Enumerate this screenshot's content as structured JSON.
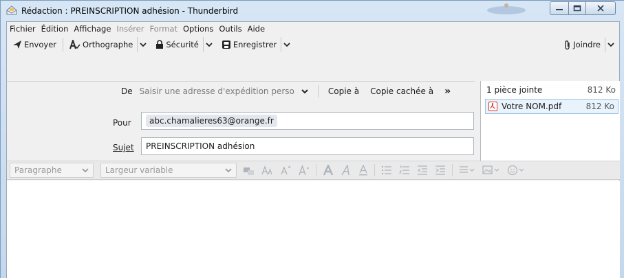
{
  "window": {
    "title": "Rédaction : PREINSCRIPTION adhésion - Thunderbird"
  },
  "menubar": {
    "items": [
      {
        "label": "Fichier",
        "disabled": false
      },
      {
        "label": "Édition",
        "disabled": false
      },
      {
        "label": "Affichage",
        "disabled": false
      },
      {
        "label": "Insérer",
        "disabled": true
      },
      {
        "label": "Format",
        "disabled": true
      },
      {
        "label": "Options",
        "disabled": false
      },
      {
        "label": "Outils",
        "disabled": false
      },
      {
        "label": "Aide",
        "disabled": false
      }
    ]
  },
  "toolbar": {
    "send_label": "Envoyer",
    "spell_label": "Orthographe",
    "security_label": "Sécurité",
    "save_label": "Enregistrer",
    "attach_label": "Joindre"
  },
  "header": {
    "from_label": "De",
    "from_placeholder": "Saisir une adresse d'expédition perso",
    "cc_label": "Copie à",
    "bcc_label": "Copie cachée à",
    "more_label": "»",
    "to_label": "Pour",
    "to_value": "abc.chamalieres63@orange.fr",
    "subject_label": "Sujet",
    "subject_value": "PREINSCRIPTION  adhésion"
  },
  "attachments": {
    "summary": "1 pièce jointe",
    "total_size": "812 Ko",
    "items": [
      {
        "name": "Votre NOM.pdf",
        "size": "812 Ko"
      }
    ]
  },
  "format_bar": {
    "paragraph_label": "Paragraphe",
    "font_label": "Largeur variable"
  },
  "colors": {
    "accent": "#3c7fc4",
    "pdf_red": "#d93025"
  }
}
